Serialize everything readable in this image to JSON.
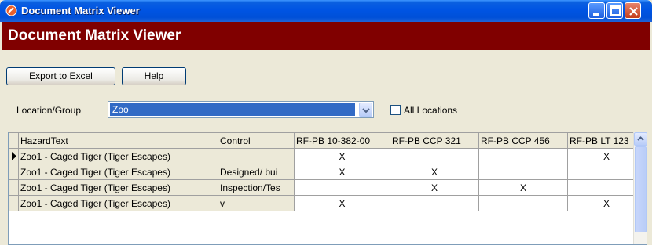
{
  "window": {
    "title": "Document Matrix Viewer"
  },
  "banner": {
    "title": "Document Matrix Viewer"
  },
  "toolbar": {
    "export_label": "Export to Excel",
    "help_label": "Help"
  },
  "location": {
    "label": "Location/Group",
    "selected": "Zoo",
    "all_locations_label": "All Locations",
    "all_locations_checked": false
  },
  "grid": {
    "headers": [
      "HazardText",
      "Control",
      "RF-PB 10-382-00",
      "RF-PB CCP 321",
      "RF-PB CCP 456",
      "RF-PB LT 123"
    ],
    "rows": [
      {
        "hazard": "Zoo1 - Caged Tiger (Tiger Escapes)",
        "control": "",
        "c1": "X",
        "c2": "",
        "c3": "",
        "c4": "X",
        "current": true
      },
      {
        "hazard": "Zoo1 - Caged Tiger (Tiger Escapes)",
        "control": "Designed/ bui",
        "c1": "X",
        "c2": "X",
        "c3": "",
        "c4": ""
      },
      {
        "hazard": "Zoo1 - Caged Tiger (Tiger Escapes)",
        "control": "Inspection/Tes",
        "c1": "",
        "c2": "X",
        "c3": "X",
        "c4": ""
      },
      {
        "hazard": "Zoo1 - Caged Tiger (Tiger Escapes)",
        "control": "v",
        "c1": "X",
        "c2": "",
        "c3": "",
        "c4": "X"
      }
    ]
  },
  "colors": {
    "banner": "#800000",
    "titlebar": "#0054e3",
    "selection": "#316ac5"
  }
}
